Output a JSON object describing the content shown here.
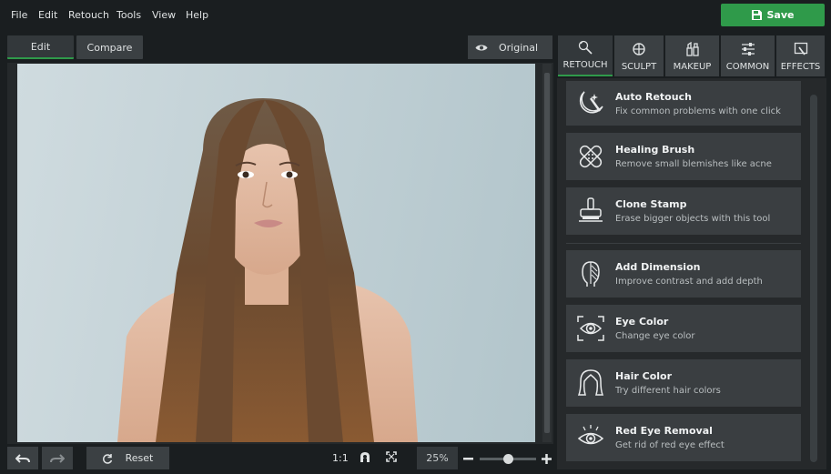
{
  "menu": [
    "File",
    "Edit",
    "Retouch",
    "Tools",
    "View",
    "Help"
  ],
  "save_label": "Save",
  "view_tabs": {
    "edit": "Edit",
    "compare": "Compare"
  },
  "original_label": "Original",
  "bottom": {
    "reset_label": "Reset",
    "one_to_one": "1:1",
    "zoom": "25%"
  },
  "right_tabs": [
    "RETOUCH",
    "SCULPT",
    "MAKEUP",
    "COMMON",
    "EFFECTS"
  ],
  "tools": [
    {
      "title": "Auto Retouch",
      "desc": "Fix common problems with one click",
      "icon": "auto-retouch-icon"
    },
    {
      "title": "Healing Brush",
      "desc": "Remove small blemishes like acne",
      "icon": "bandage-icon"
    },
    {
      "title": "Clone Stamp",
      "desc": "Erase bigger objects with this tool",
      "icon": "stamp-icon"
    },
    {
      "title": "Add Dimension",
      "desc": "Improve contrast and add depth",
      "icon": "face-dimension-icon"
    },
    {
      "title": "Eye Color",
      "desc": "Change eye color",
      "icon": "eye-focus-icon"
    },
    {
      "title": "Hair Color",
      "desc": "Try different hair colors",
      "icon": "hair-icon"
    },
    {
      "title": "Red Eye Removal",
      "desc": "Get rid of red eye effect",
      "icon": "red-eye-icon"
    }
  ],
  "colors": {
    "accent": "#2f9a4a",
    "panel": "#3a3e41",
    "background": "#1a1e20"
  }
}
